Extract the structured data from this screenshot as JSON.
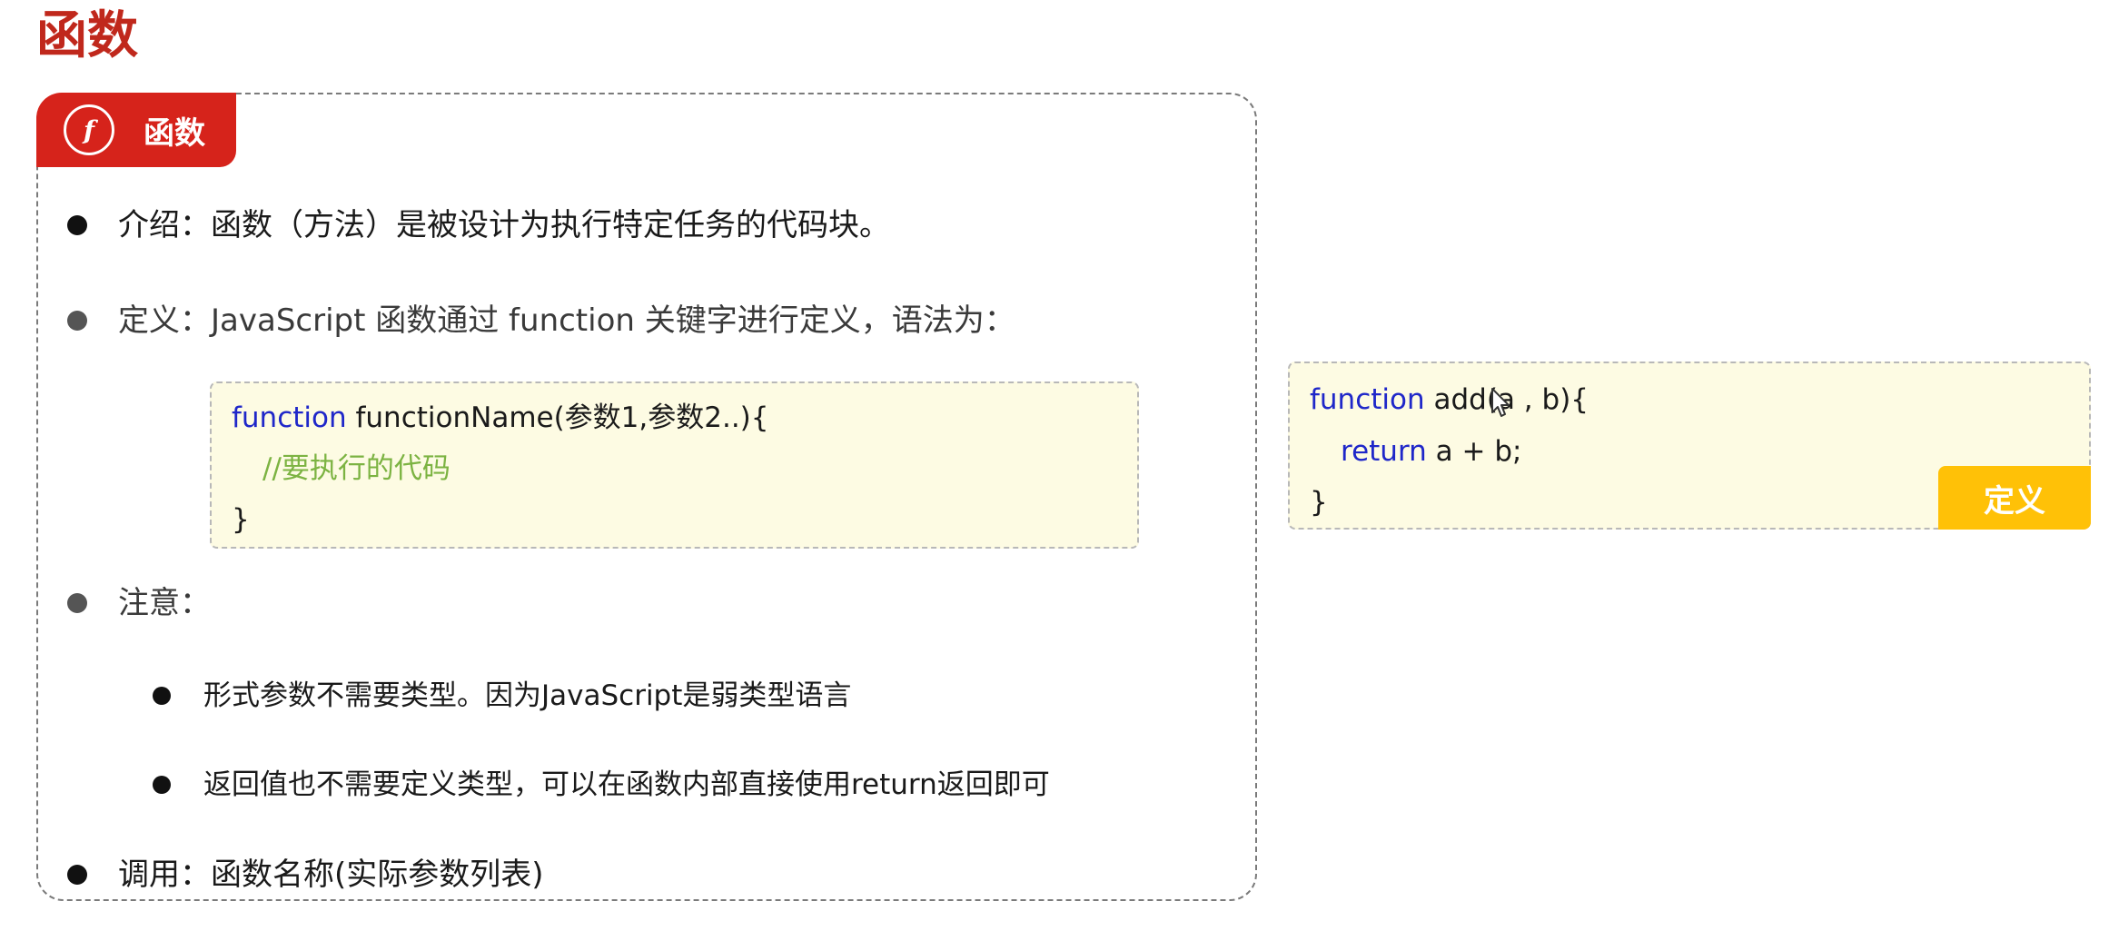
{
  "page": {
    "title": "函数"
  },
  "card": {
    "tab_icon": "f",
    "tab_label": "函数",
    "items": [
      "介绍：函数（方法）是被设计为执行特定任务的代码块。",
      "定义：JavaScript 函数通过 function 关键字进行定义，语法为：",
      "注意：",
      "调用：函数名称(实际参数列表)"
    ],
    "sub_items": [
      "形式参数不需要类型。因为JavaScript是弱类型语言",
      "返回值也不需要定义类型，可以在函数内部直接使用return返回即可"
    ],
    "syntax_code": {
      "line1_kw": "function",
      "line1_rest": " functionName(参数1,参数2..){",
      "line2_comment": "//要执行的代码",
      "line3": "}"
    }
  },
  "example": {
    "line1_kw": "function",
    "line1_rest_a": " add(",
    "line1_rest_b": "a",
    "line1_rest_c": " , b){",
    "line2_kw": "return",
    "line2_rest": " a + b;",
    "line3": "}",
    "tag": "定义"
  },
  "colors": {
    "accent_red": "#d6231b",
    "title_red": "#c0281c",
    "keyword_blue": "#1f27c9",
    "comment_green": "#7cb342",
    "tag_yellow": "#ffc107",
    "code_bg": "#fdfbe3"
  },
  "icons": [
    "function-f-icon",
    "mouse-pointer-icon"
  ]
}
